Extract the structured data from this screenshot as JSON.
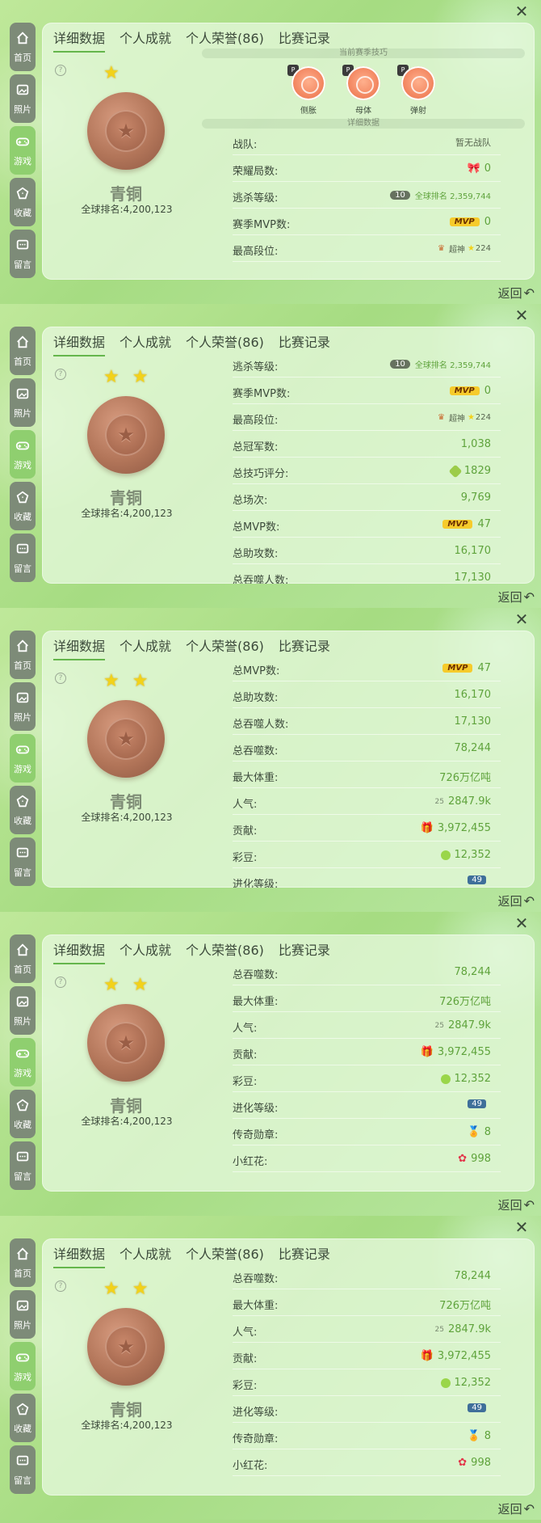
{
  "sidebar": {
    "items": [
      {
        "label": "首页",
        "icon": "home-icon"
      },
      {
        "label": "照片",
        "icon": "photo-icon"
      },
      {
        "label": "游戏",
        "icon": "gamepad-icon"
      },
      {
        "label": "收藏",
        "icon": "collect-icon"
      },
      {
        "label": "留言",
        "icon": "message-icon"
      }
    ]
  },
  "tabs": [
    "详细数据",
    "个人成就",
    "个人荣誉(86)",
    "比赛记录"
  ],
  "profile": {
    "rank_name": "青铜",
    "global_rank": "全球排名:4,200,123",
    "help_glyph": "?"
  },
  "skills_section": {
    "title": "当前赛季技巧",
    "skills": [
      "侧胀",
      "母体",
      "弹射"
    ],
    "detail_title": "详细数据"
  },
  "stats": {
    "team": {
      "label": "战队:",
      "value": "暂无战队"
    },
    "honor_games": {
      "label": "荣耀局数:",
      "value": "0"
    },
    "kill_level": {
      "label": "逃杀等级:",
      "badge": "10",
      "rank_text": "全球排名 2,359,744"
    },
    "season_mvp": {
      "label": "赛季MVP数:",
      "badge": "MVP",
      "value": "0"
    },
    "max_tier": {
      "label": "最高段位:",
      "tier": "超神",
      "value": "224"
    },
    "total_champion": {
      "label": "总冠军数:",
      "value": "1,038"
    },
    "skill_score": {
      "label": "总技巧评分:",
      "value": "1829"
    },
    "total_games": {
      "label": "总场次:",
      "value": "9,769"
    },
    "total_mvp": {
      "label": "总MVP数:",
      "badge": "MVP",
      "value": "47"
    },
    "total_assist": {
      "label": "总助攻数:",
      "value": "16,170"
    },
    "total_eat_people": {
      "label": "总吞噬人数:",
      "value": "17,130"
    },
    "total_eat": {
      "label": "总吞噬数:",
      "value": "78,244"
    },
    "max_weight": {
      "label": "最大体重:",
      "value": "726万亿吨"
    },
    "popularity": {
      "label": "人气:",
      "badge": "25",
      "value": "2847.9k"
    },
    "contribution": {
      "label": "贡献:",
      "value": "3,972,455"
    },
    "beans": {
      "label": "彩豆:",
      "value": "12,352"
    },
    "evolve_level": {
      "label": "进化等级:",
      "value": "49"
    },
    "legend_medal": {
      "label": "传奇勋章:",
      "value": "8"
    },
    "red_flower": {
      "label": "小红花:",
      "value": "998"
    }
  },
  "nav": {
    "back_label": "返回",
    "close_glyph": "✕"
  },
  "colors": {
    "accent": "#65b64c",
    "value_green": "#5fa33c",
    "sidebar": "#7d8b78",
    "sidebar_active": "#8fcf6f"
  }
}
